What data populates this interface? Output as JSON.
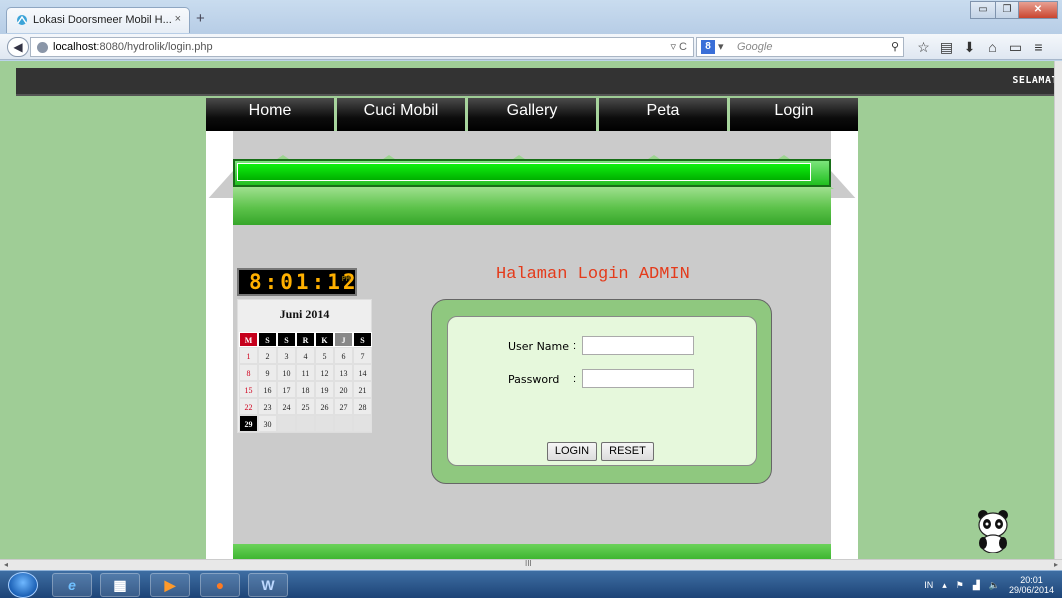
{
  "browser": {
    "tab_title": "Lokasi Doorsmeer Mobil H...",
    "tab_close": "×",
    "new_tab": "+",
    "url_host": "localhost",
    "url_rest": ":8080/hydrolik/login.php",
    "search_placeholder": "Google",
    "search_engine_badge": "8",
    "window_buttons": [
      "▭",
      "❐",
      "✕"
    ]
  },
  "site": {
    "marquee": "SELAMAT",
    "menu": [
      "Home",
      "Cuci Mobil",
      "Gallery",
      "Peta",
      "Login"
    ],
    "colors": {
      "page_bg": "#9fcd96",
      "accent_green": "#20c01e",
      "title_red": "#e43b1b"
    }
  },
  "clock": {
    "time": "8:01:12",
    "ampm": "PM"
  },
  "calendar": {
    "title": "Juni 2014",
    "weekdays": [
      "M",
      "S",
      "S",
      "R",
      "K",
      "J",
      "S"
    ],
    "weeks": [
      [
        "1",
        "2",
        "3",
        "4",
        "5",
        "6",
        "7"
      ],
      [
        "8",
        "9",
        "10",
        "11",
        "12",
        "13",
        "14"
      ],
      [
        "15",
        "16",
        "17",
        "18",
        "19",
        "20",
        "21"
      ],
      [
        "22",
        "23",
        "24",
        "25",
        "26",
        "27",
        "28"
      ],
      [
        "29",
        "30",
        "",
        "",
        "",
        "",
        ""
      ]
    ],
    "today": "29"
  },
  "login": {
    "title": "Halaman Login ADMIN",
    "username_label": "User Name",
    "password_label": "Password",
    "colon": ":",
    "login_button": "LOGIN",
    "reset_button": "RESET"
  },
  "taskbar": {
    "lang": "IN",
    "time": "20:01",
    "date": "29/06/2014"
  }
}
